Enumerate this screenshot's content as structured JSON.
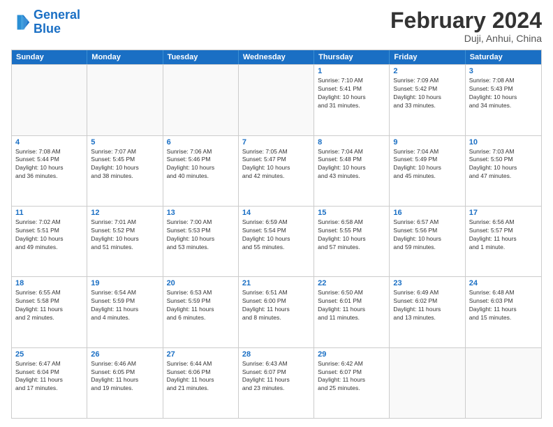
{
  "header": {
    "logo_line1": "General",
    "logo_line2": "Blue",
    "month": "February 2024",
    "location": "Duji, Anhui, China"
  },
  "weekdays": [
    "Sunday",
    "Monday",
    "Tuesday",
    "Wednesday",
    "Thursday",
    "Friday",
    "Saturday"
  ],
  "rows": [
    [
      {
        "day": "",
        "lines": []
      },
      {
        "day": "",
        "lines": []
      },
      {
        "day": "",
        "lines": []
      },
      {
        "day": "",
        "lines": []
      },
      {
        "day": "1",
        "lines": [
          "Sunrise: 7:10 AM",
          "Sunset: 5:41 PM",
          "Daylight: 10 hours",
          "and 31 minutes."
        ]
      },
      {
        "day": "2",
        "lines": [
          "Sunrise: 7:09 AM",
          "Sunset: 5:42 PM",
          "Daylight: 10 hours",
          "and 33 minutes."
        ]
      },
      {
        "day": "3",
        "lines": [
          "Sunrise: 7:08 AM",
          "Sunset: 5:43 PM",
          "Daylight: 10 hours",
          "and 34 minutes."
        ]
      }
    ],
    [
      {
        "day": "4",
        "lines": [
          "Sunrise: 7:08 AM",
          "Sunset: 5:44 PM",
          "Daylight: 10 hours",
          "and 36 minutes."
        ]
      },
      {
        "day": "5",
        "lines": [
          "Sunrise: 7:07 AM",
          "Sunset: 5:45 PM",
          "Daylight: 10 hours",
          "and 38 minutes."
        ]
      },
      {
        "day": "6",
        "lines": [
          "Sunrise: 7:06 AM",
          "Sunset: 5:46 PM",
          "Daylight: 10 hours",
          "and 40 minutes."
        ]
      },
      {
        "day": "7",
        "lines": [
          "Sunrise: 7:05 AM",
          "Sunset: 5:47 PM",
          "Daylight: 10 hours",
          "and 42 minutes."
        ]
      },
      {
        "day": "8",
        "lines": [
          "Sunrise: 7:04 AM",
          "Sunset: 5:48 PM",
          "Daylight: 10 hours",
          "and 43 minutes."
        ]
      },
      {
        "day": "9",
        "lines": [
          "Sunrise: 7:04 AM",
          "Sunset: 5:49 PM",
          "Daylight: 10 hours",
          "and 45 minutes."
        ]
      },
      {
        "day": "10",
        "lines": [
          "Sunrise: 7:03 AM",
          "Sunset: 5:50 PM",
          "Daylight: 10 hours",
          "and 47 minutes."
        ]
      }
    ],
    [
      {
        "day": "11",
        "lines": [
          "Sunrise: 7:02 AM",
          "Sunset: 5:51 PM",
          "Daylight: 10 hours",
          "and 49 minutes."
        ]
      },
      {
        "day": "12",
        "lines": [
          "Sunrise: 7:01 AM",
          "Sunset: 5:52 PM",
          "Daylight: 10 hours",
          "and 51 minutes."
        ]
      },
      {
        "day": "13",
        "lines": [
          "Sunrise: 7:00 AM",
          "Sunset: 5:53 PM",
          "Daylight: 10 hours",
          "and 53 minutes."
        ]
      },
      {
        "day": "14",
        "lines": [
          "Sunrise: 6:59 AM",
          "Sunset: 5:54 PM",
          "Daylight: 10 hours",
          "and 55 minutes."
        ]
      },
      {
        "day": "15",
        "lines": [
          "Sunrise: 6:58 AM",
          "Sunset: 5:55 PM",
          "Daylight: 10 hours",
          "and 57 minutes."
        ]
      },
      {
        "day": "16",
        "lines": [
          "Sunrise: 6:57 AM",
          "Sunset: 5:56 PM",
          "Daylight: 10 hours",
          "and 59 minutes."
        ]
      },
      {
        "day": "17",
        "lines": [
          "Sunrise: 6:56 AM",
          "Sunset: 5:57 PM",
          "Daylight: 11 hours",
          "and 1 minute."
        ]
      }
    ],
    [
      {
        "day": "18",
        "lines": [
          "Sunrise: 6:55 AM",
          "Sunset: 5:58 PM",
          "Daylight: 11 hours",
          "and 2 minutes."
        ]
      },
      {
        "day": "19",
        "lines": [
          "Sunrise: 6:54 AM",
          "Sunset: 5:59 PM",
          "Daylight: 11 hours",
          "and 4 minutes."
        ]
      },
      {
        "day": "20",
        "lines": [
          "Sunrise: 6:53 AM",
          "Sunset: 5:59 PM",
          "Daylight: 11 hours",
          "and 6 minutes."
        ]
      },
      {
        "day": "21",
        "lines": [
          "Sunrise: 6:51 AM",
          "Sunset: 6:00 PM",
          "Daylight: 11 hours",
          "and 8 minutes."
        ]
      },
      {
        "day": "22",
        "lines": [
          "Sunrise: 6:50 AM",
          "Sunset: 6:01 PM",
          "Daylight: 11 hours",
          "and 11 minutes."
        ]
      },
      {
        "day": "23",
        "lines": [
          "Sunrise: 6:49 AM",
          "Sunset: 6:02 PM",
          "Daylight: 11 hours",
          "and 13 minutes."
        ]
      },
      {
        "day": "24",
        "lines": [
          "Sunrise: 6:48 AM",
          "Sunset: 6:03 PM",
          "Daylight: 11 hours",
          "and 15 minutes."
        ]
      }
    ],
    [
      {
        "day": "25",
        "lines": [
          "Sunrise: 6:47 AM",
          "Sunset: 6:04 PM",
          "Daylight: 11 hours",
          "and 17 minutes."
        ]
      },
      {
        "day": "26",
        "lines": [
          "Sunrise: 6:46 AM",
          "Sunset: 6:05 PM",
          "Daylight: 11 hours",
          "and 19 minutes."
        ]
      },
      {
        "day": "27",
        "lines": [
          "Sunrise: 6:44 AM",
          "Sunset: 6:06 PM",
          "Daylight: 11 hours",
          "and 21 minutes."
        ]
      },
      {
        "day": "28",
        "lines": [
          "Sunrise: 6:43 AM",
          "Sunset: 6:07 PM",
          "Daylight: 11 hours",
          "and 23 minutes."
        ]
      },
      {
        "day": "29",
        "lines": [
          "Sunrise: 6:42 AM",
          "Sunset: 6:07 PM",
          "Daylight: 11 hours",
          "and 25 minutes."
        ]
      },
      {
        "day": "",
        "lines": []
      },
      {
        "day": "",
        "lines": []
      }
    ]
  ]
}
